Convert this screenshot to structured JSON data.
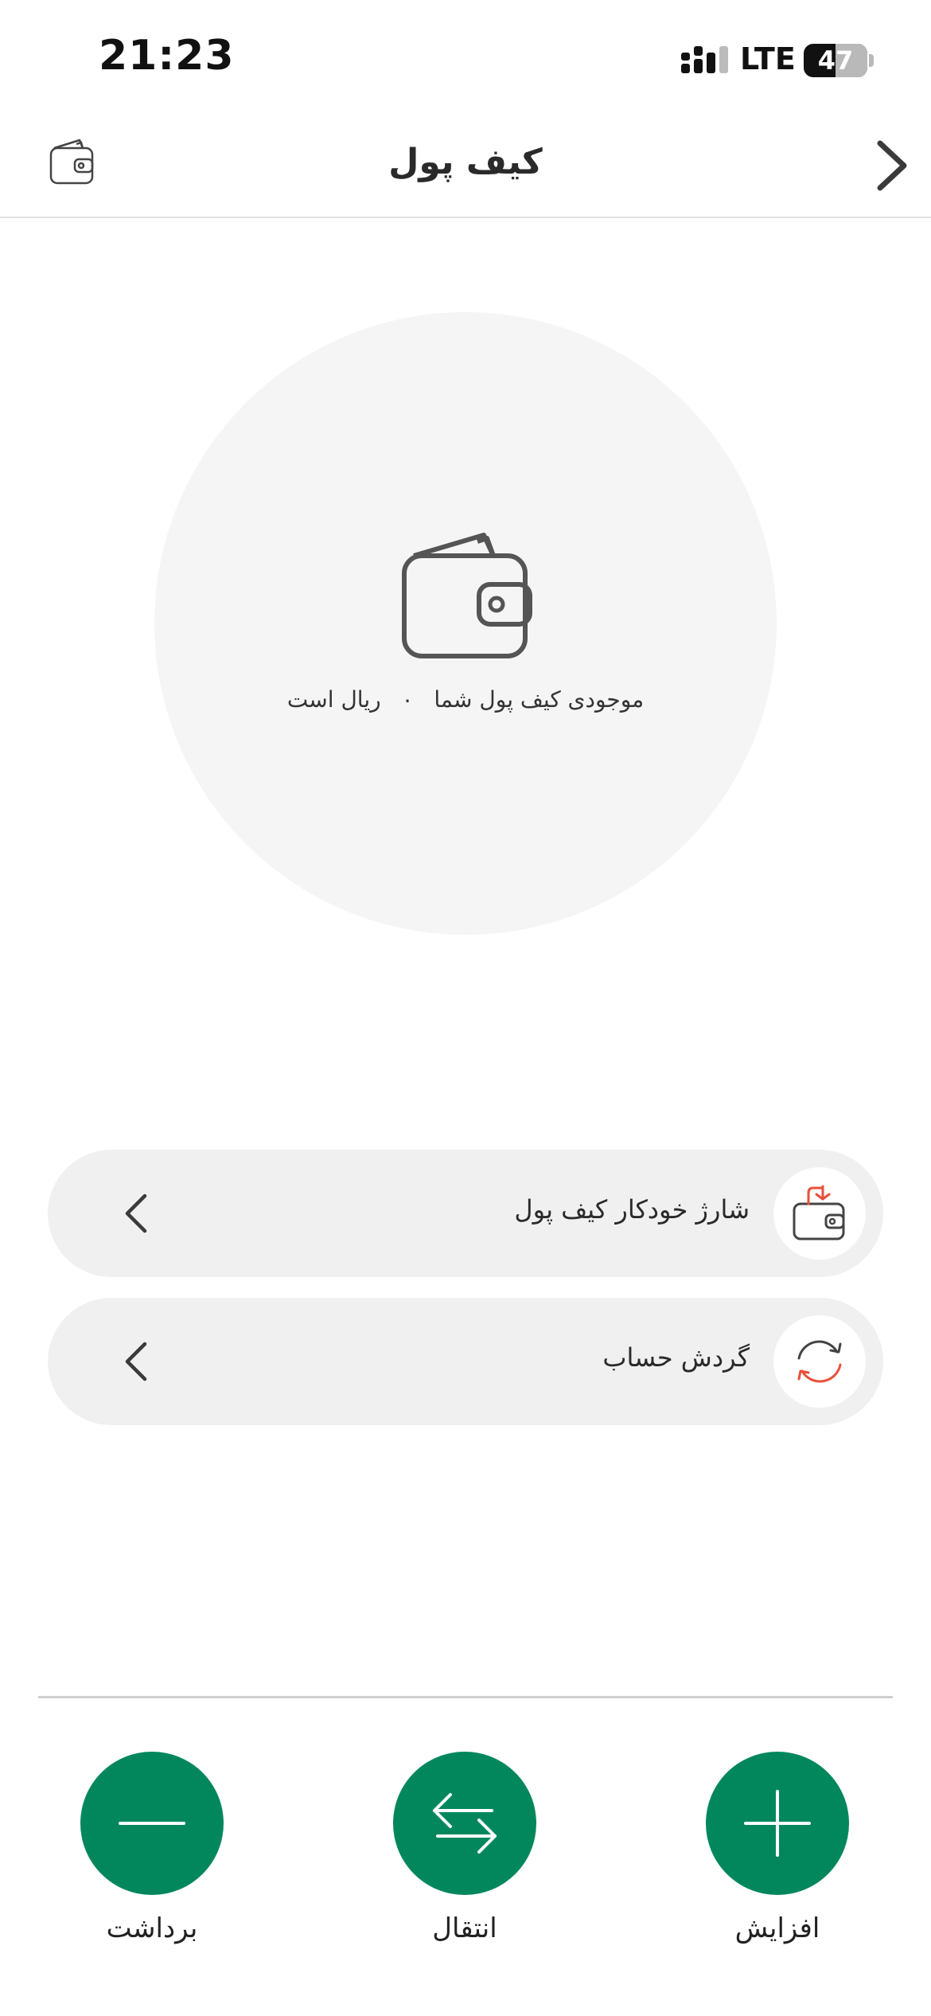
{
  "status_bar": {
    "time": "21:23",
    "network": "LTE",
    "battery": "47"
  },
  "header": {
    "title": "کیف پول",
    "back_icon": "chevron-right-icon",
    "wallet_icon": "wallet-icon"
  },
  "balance": {
    "prefix": "موجودی کیف پول شما",
    "amount": "۰",
    "suffix": "ریال است",
    "icon": "wallet-icon"
  },
  "options": [
    {
      "label": "شارژ خودکار کیف پول",
      "icon": "wallet-recharge-icon"
    },
    {
      "label": "گردش حساب",
      "icon": "refresh-icon"
    }
  ],
  "actions": [
    {
      "label": "افزایش",
      "icon": "plus-icon"
    },
    {
      "label": "انتقال",
      "icon": "transfer-icon"
    },
    {
      "label": "برداشت",
      "icon": "minus-icon"
    }
  ],
  "colors": {
    "primary": "#02875d",
    "accent": "#e8503a",
    "circle_bg": "#f5f5f5",
    "row_bg": "#f0f0f0"
  }
}
